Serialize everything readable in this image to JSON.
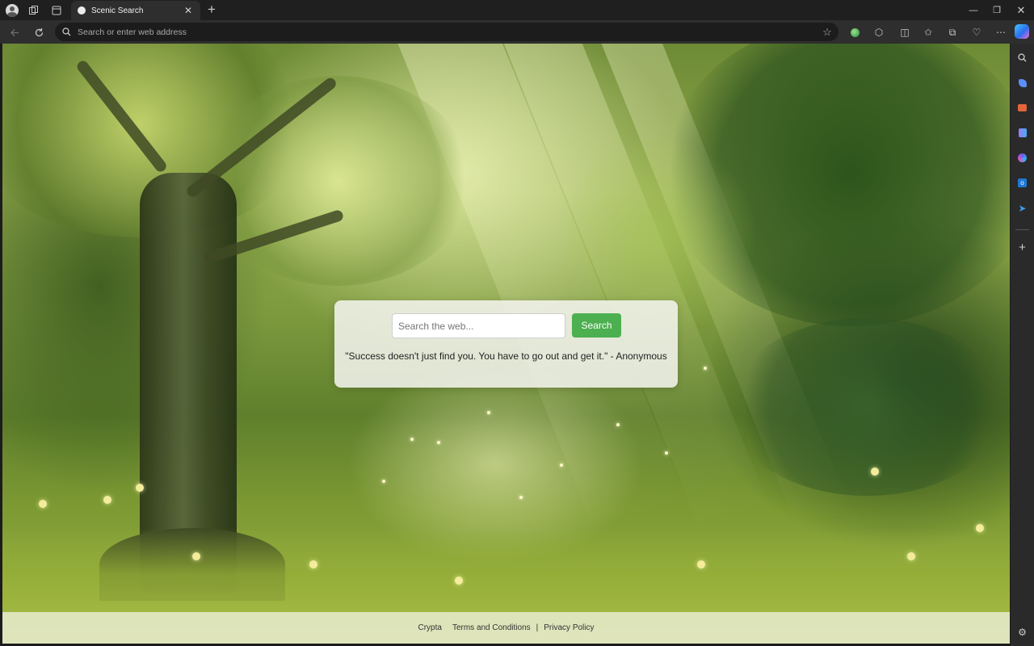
{
  "browser": {
    "tab": {
      "title": "Scenic Search"
    },
    "address_bar": {
      "placeholder": "Search or enter web address"
    }
  },
  "search": {
    "placeholder": "Search the web...",
    "button_label": "Search"
  },
  "quote": "\"Success doesn't just find you. You have to go out and get it.\" - Anonymous",
  "footer": {
    "links": [
      "Crypta",
      "Terms and Conditions",
      "Privacy Policy"
    ],
    "separator": "|"
  },
  "colors": {
    "accent_button": "#4caf50",
    "browser_chrome": "#1f1f1f"
  }
}
